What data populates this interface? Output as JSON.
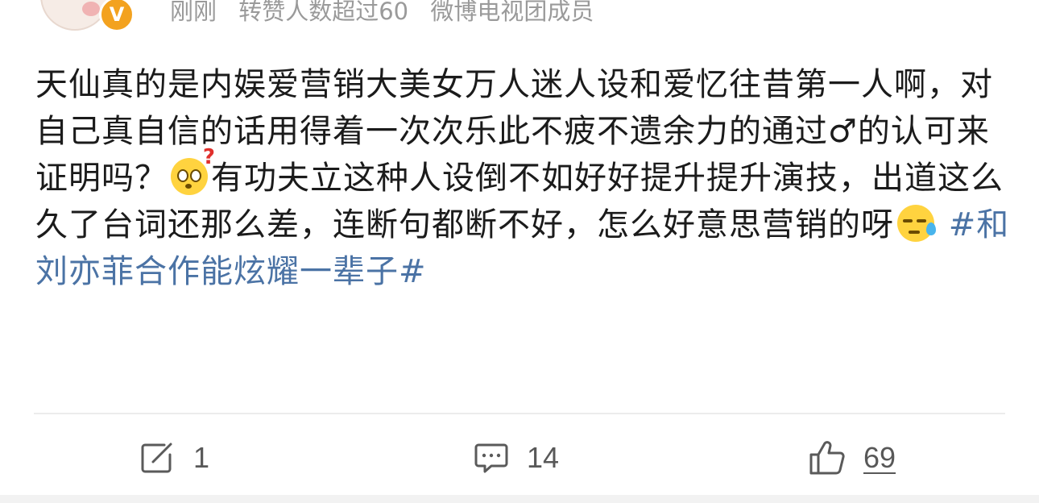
{
  "post": {
    "author_badge": "V",
    "meta": {
      "time": "刚刚",
      "repost_info": "转赞人数超过60",
      "group": "微博电视团成员"
    },
    "text_part1": "天仙真的是内娱爱营销大美女万人迷人设和爱忆往昔第一人啊，对自己真自信的话用得着一次次乐此不疲不遗余力的通过♂的认可来证明吗？",
    "emoji1": "confused-emoji",
    "text_part2": "有功夫立这种人设倒不如好好提升提升演技，出道这么久了台词还那么差，连断句都断不好，怎么好意思营销的呀",
    "emoji2": "sweat-emoji",
    "topic": "#和刘亦菲合作能炫耀一辈子#"
  },
  "actions": {
    "repost": {
      "icon": "repost-icon",
      "count": "1"
    },
    "comment": {
      "icon": "comment-icon",
      "count": "14"
    },
    "like": {
      "icon": "thumbs-up-icon",
      "count": "69"
    }
  },
  "colors": {
    "topic": "#4b73a5",
    "meta": "#9a9a9a",
    "badge": "#f3a21f"
  }
}
